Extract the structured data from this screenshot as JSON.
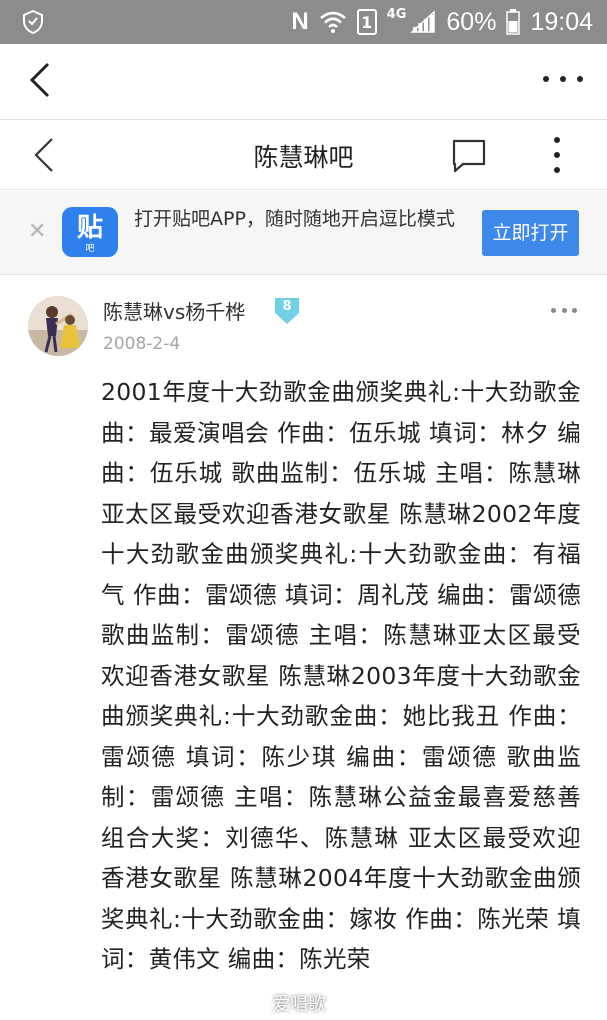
{
  "status_bar": {
    "carrier_n": "N",
    "sim_slot": "1",
    "network": "4G",
    "battery": "60%",
    "time": "19:04"
  },
  "browser": {
    "back_icon": "chevron-left-icon",
    "more_icon": "horizontal-more-icon"
  },
  "header": {
    "title": "陈慧琳吧",
    "chat_icon": "chat-bubble-icon",
    "more_icon": "vertical-more-icon"
  },
  "banner": {
    "close_glyph": "✕",
    "logo_text": "贴",
    "logo_mini": "吧",
    "text": "打开贴吧APP，随时随地开启逗比模式",
    "button": "立即打开",
    "accent": "#3d88e8"
  },
  "post": {
    "username": "陈慧琳vs杨千桦",
    "level": "8",
    "date": "2008-2-4",
    "body": "2001年度十大劲歌金曲颁奖典礼:十大劲歌金曲：最爱演唱会 作曲：伍乐城 填词：林夕 编曲：伍乐城 歌曲监制：伍乐城 主唱：陈慧琳亚太区最受欢迎香港女歌星 陈慧琳2002年度十大劲歌金曲颁奖典礼:十大劲歌金曲：有福气 作曲：雷颂德 填词：周礼茂 编曲：雷颂德 歌曲监制：雷颂德 主唱：陈慧琳亚太区最受欢迎香港女歌星 陈慧琳2003年度十大劲歌金曲颁奖典礼:十大劲歌金曲：她比我丑 作曲：雷颂德 填词：陈少琪 编曲：雷颂德 歌曲监制：雷颂德 主唱：陈慧琳公益金最喜爱慈善组合大奖：刘德华、陈慧琳 亚太区最受欢迎香港女歌星 陈慧琳2004年度十大劲歌金曲颁奖典礼:十大劲歌金曲：嫁妆 作曲：陈光荣 填词：黄伟文 编曲：陈光荣"
  },
  "watermark": "爱唱歌"
}
